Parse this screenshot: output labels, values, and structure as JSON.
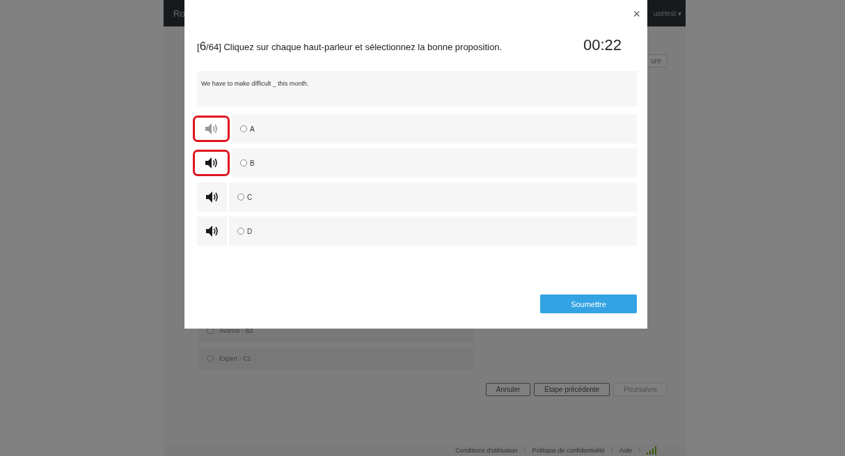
{
  "background_page": {
    "header": {
      "brand": "Ro",
      "user_menu": "usetest ▾"
    },
    "top_button": "ure",
    "levels": [
      {
        "label": "Avancé - B2",
        "selected": false
      },
      {
        "label": "Expert - C1",
        "selected": false
      }
    ],
    "buttons": [
      {
        "label": "Annuler",
        "disabled": false
      },
      {
        "label": "Étape précédente",
        "disabled": false
      },
      {
        "label": "Poursuivre",
        "disabled": true
      }
    ],
    "footer_links": [
      "Conditions d'utilisation",
      "Politique de confidentialité",
      "Aide"
    ]
  },
  "modal": {
    "close": "×",
    "question": {
      "open_bracket": "[",
      "number": "6",
      "rest": "/64] Cliquez sur chaque haut-parleur et sélectionnez la bonne proposition."
    },
    "timer": "00:22",
    "sentence": "We have to make difficult _ this month.",
    "options": [
      {
        "label": "A",
        "played": true,
        "highlighted": true,
        "selected": false
      },
      {
        "label": "B",
        "played": false,
        "highlighted": true,
        "selected": false
      },
      {
        "label": "C",
        "played": false,
        "highlighted": false,
        "selected": false
      },
      {
        "label": "D",
        "played": false,
        "highlighted": false,
        "selected": false
      }
    ],
    "submit": "Soumettre"
  }
}
